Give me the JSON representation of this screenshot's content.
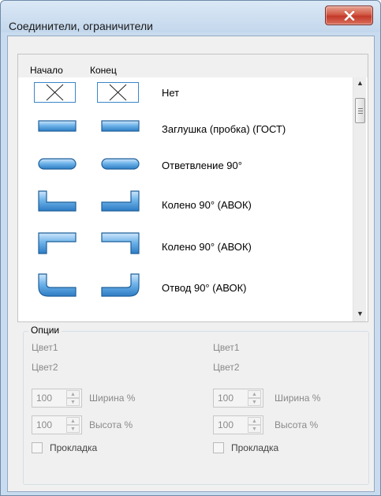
{
  "window": {
    "title": "Соединители, ограничители"
  },
  "columns": {
    "start": "Начало",
    "end": "Конец"
  },
  "items": [
    {
      "label": "Нет",
      "icon": "none-x-icon"
    },
    {
      "label": "Заглушка (пробка) (ГОСТ)",
      "icon": "plug-cap-icon"
    },
    {
      "label": "Ответвление 90°",
      "icon": "branch-90-icon"
    },
    {
      "label": "Колено 90° (АВОК)",
      "icon": "elbow-90-icon"
    },
    {
      "label": "Колено 90° (АВОК)",
      "icon": "elbow-90-alt-icon"
    },
    {
      "label": "Отвод 90° (АВОК)",
      "icon": "bend-90-icon"
    }
  ],
  "options": {
    "legend": "Опции",
    "start": {
      "color1": "Цвет1",
      "color2": "Цвет2",
      "width_value": "100",
      "width_label": "Ширина %",
      "height_value": "100",
      "height_label": "Высота %",
      "gasket_label": "Прокладка",
      "gasket_checked": false
    },
    "end": {
      "color1": "Цвет1",
      "color2": "Цвет2",
      "width_value": "100",
      "width_label": "Ширина %",
      "height_value": "100",
      "height_label": "Высота %",
      "gasket_label": "Прокладка",
      "gasket_checked": false
    }
  },
  "colors": {
    "pipe_fill": "#4f9fdc",
    "pipe_highlight": "#cfe7fb",
    "pipe_outline": "#1f5f9a",
    "close_button": "#c4392a",
    "selection_border": "#3b86c8"
  }
}
